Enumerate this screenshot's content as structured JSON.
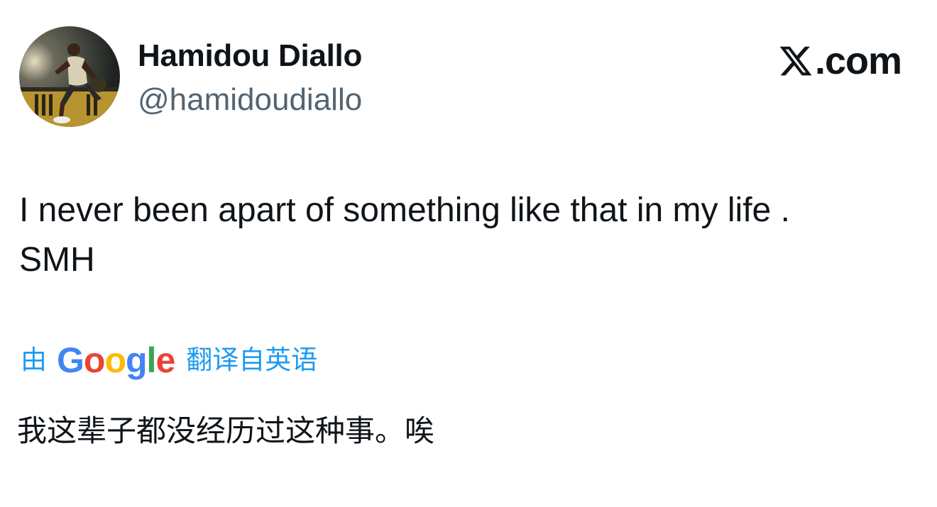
{
  "author": {
    "display_name": "Hamidou Diallo",
    "handle": "@hamidoudiallo"
  },
  "brand": {
    "icon": "x-logo-icon",
    "text": ".com"
  },
  "tweet": {
    "lines": [
      "I never been apart of something like that in my life .",
      "SMH"
    ]
  },
  "translation": {
    "prefix": "由",
    "provider_logo": "Google",
    "suffix": "翻译自英语",
    "text": "我这辈子都没经历过这种事。唉"
  },
  "colors": {
    "link_blue": "#1d9bf0",
    "handle_gray": "#536471",
    "text": "#0f1419"
  }
}
